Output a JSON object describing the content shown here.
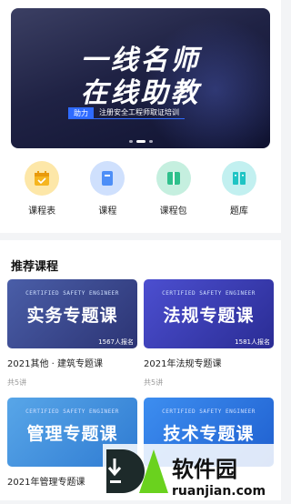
{
  "banner": {
    "line1": "一线名师",
    "line2": "在线助教",
    "tag_badge": "助力",
    "tag_text": "注册安全工程师取证培训"
  },
  "nav": [
    {
      "label": "课程表",
      "icon": "calendar-icon",
      "color": "#f5b51f"
    },
    {
      "label": "课程",
      "icon": "book-icon",
      "color": "#4d8ef7"
    },
    {
      "label": "课程包",
      "icon": "package-icon",
      "color": "#2fc08c"
    },
    {
      "label": "题库",
      "icon": "question-bank-icon",
      "color": "#1fc4c4"
    }
  ],
  "section": {
    "title": "推荐课程"
  },
  "courses": [
    {
      "banner_sub": "CERTIFIED SAFETY ENGINEER",
      "banner_title": "实务专题课",
      "count": "1567人报名",
      "title": "2021其他 · 建筑专题课",
      "meta": "共5讲"
    },
    {
      "banner_sub": "CERTIFIED SAFETY ENGINEER",
      "banner_title": "法规专题课",
      "count": "1581人报名",
      "title": "2021年法规专题课",
      "meta": "共5讲"
    },
    {
      "banner_sub": "CERTIFIED SAFETY ENGINEER",
      "banner_title": "管理专题课",
      "count": "",
      "title": "2021年管理专题课",
      "meta": ""
    },
    {
      "banner_sub": "CERTIFIED SAFETY ENGINEER",
      "banner_title": "技术专题课",
      "count": "",
      "title": "",
      "meta": ""
    }
  ],
  "watermark": {
    "brand": "软件园",
    "url": "ruanjian.com"
  }
}
